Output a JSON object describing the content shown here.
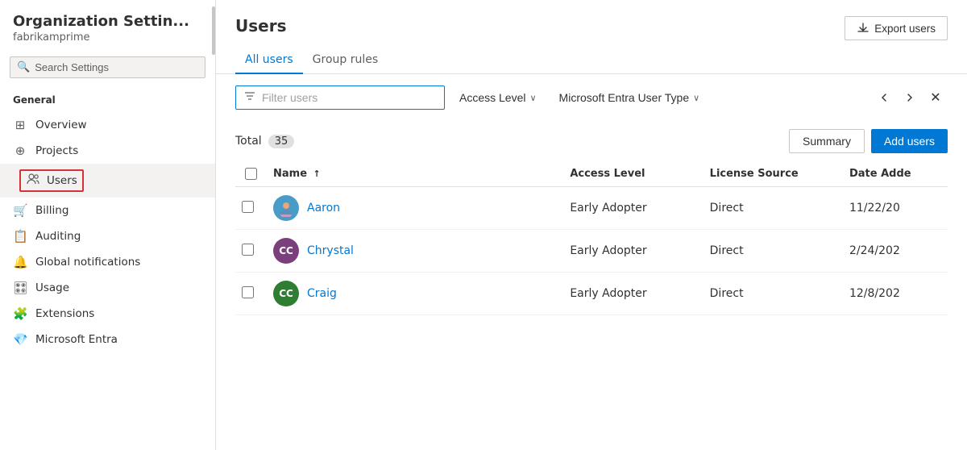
{
  "sidebar": {
    "title": "Organization Settin...",
    "subtitle": "fabrikamprime",
    "search_placeholder": "Search Settings",
    "general_label": "General",
    "nav_items": [
      {
        "id": "overview",
        "label": "Overview",
        "icon": "⊞"
      },
      {
        "id": "projects",
        "label": "Projects",
        "icon": "⊕"
      },
      {
        "id": "users",
        "label": "Users",
        "icon": "👥",
        "active": true
      },
      {
        "id": "billing",
        "label": "Billing",
        "icon": "🛒"
      },
      {
        "id": "auditing",
        "label": "Auditing",
        "icon": "📋"
      },
      {
        "id": "global-notifications",
        "label": "Global notifications",
        "icon": "🔔"
      },
      {
        "id": "usage",
        "label": "Usage",
        "icon": "🎛"
      },
      {
        "id": "extensions",
        "label": "Extensions",
        "icon": "🧩"
      },
      {
        "id": "microsoft-entra",
        "label": "Microsoft Entra",
        "icon": "💎"
      }
    ]
  },
  "main": {
    "page_title": "Users",
    "export_button_label": "Export users",
    "tabs": [
      {
        "id": "all-users",
        "label": "All users",
        "active": true
      },
      {
        "id": "group-rules",
        "label": "Group rules",
        "active": false
      }
    ],
    "filter": {
      "placeholder": "Filter users",
      "access_level_label": "Access Level",
      "user_type_label": "Microsoft Entra User Type"
    },
    "table": {
      "total_label": "Total",
      "total_count": "35",
      "summary_button": "Summary",
      "add_users_button": "Add users",
      "columns": {
        "name": "Name",
        "sort_indicator": "↑",
        "access_level": "Access Level",
        "license_source": "License Source",
        "date_added": "Date Adde"
      },
      "rows": [
        {
          "id": "aaron",
          "name": "Aaron",
          "avatar_type": "image",
          "avatar_initials": "",
          "avatar_color": "#4a9cc8",
          "access_level": "Early Adopter",
          "license_source": "Direct",
          "date_added": "11/22/20"
        },
        {
          "id": "chrystal",
          "name": "Chrystal",
          "avatar_type": "initials",
          "avatar_initials": "CC",
          "avatar_color": "#7b3f7b",
          "access_level": "Early Adopter",
          "license_source": "Direct",
          "date_added": "2/24/202"
        },
        {
          "id": "craig",
          "name": "Craig",
          "avatar_type": "initials",
          "avatar_initials": "CC",
          "avatar_color": "#2e7d32",
          "access_level": "Early Adopter",
          "license_source": "Direct",
          "date_added": "12/8/202"
        }
      ]
    }
  }
}
